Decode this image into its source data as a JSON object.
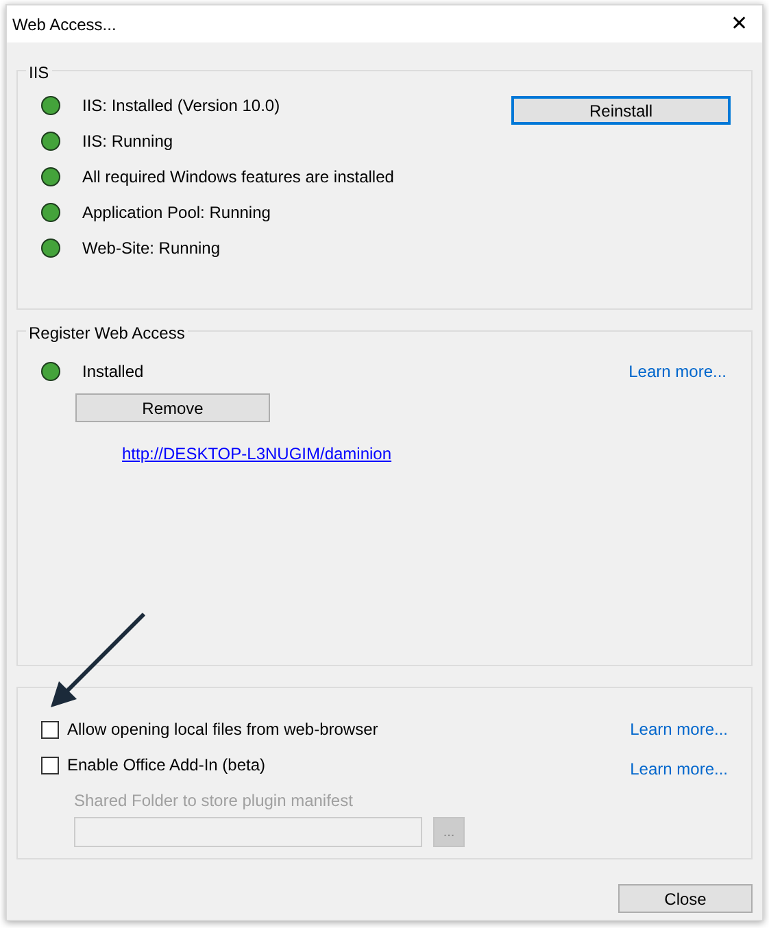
{
  "window": {
    "title": "Web Access...",
    "close_glyph": "✕"
  },
  "iis": {
    "title": "IIS",
    "statuses": [
      {
        "text": "IIS: Installed (Version 10.0)",
        "color": "#44a33b"
      },
      {
        "text": "IIS: Running",
        "color": "#44a33b"
      },
      {
        "text": "All required Windows features are installed",
        "color": "#44a33b"
      },
      {
        "text": "Application Pool: Running",
        "color": "#44a33b"
      },
      {
        "text": "Web-Site: Running",
        "color": "#44a33b"
      }
    ],
    "button": {
      "label": "Reinstall",
      "focused": true
    }
  },
  "register": {
    "title": "Register Web Access",
    "status": {
      "text": "Installed",
      "color": "#44a33b"
    },
    "learn_more": "Learn more...",
    "button": {
      "label": "Remove",
      "focused": false
    },
    "url": "http://DESKTOP-L3NUGIM/daminion"
  },
  "options": {
    "checkboxes": [
      {
        "label": "Allow opening local files from web-browser",
        "checked": false,
        "learn_more": "Learn more..."
      },
      {
        "label": "Enable Office Add-In (beta)",
        "checked": false,
        "learn_more": "Learn more..."
      }
    ],
    "folder": {
      "label": "Shared Folder to store plugin manifest",
      "disabled": true,
      "browse": "..."
    }
  },
  "close_button": "Close",
  "annotation": {
    "kind": "arrow"
  }
}
